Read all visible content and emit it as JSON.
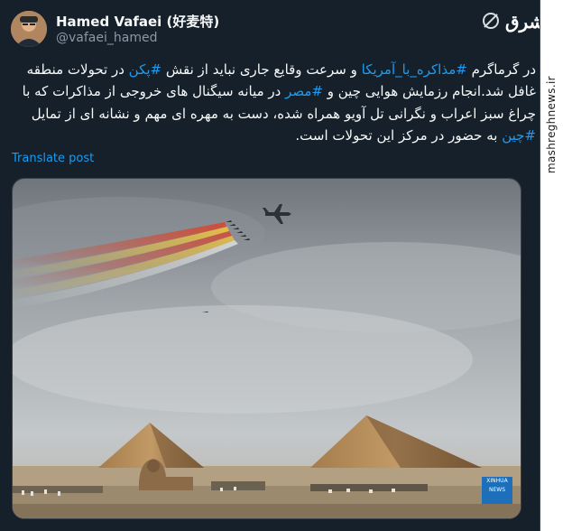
{
  "author": {
    "name": "Hamed Vafaei   (好麦特)",
    "handle": "@vafaei_hamed"
  },
  "tweet": {
    "line1_pre": "در گرماگرم ",
    "hashtag1": "#مذاکره_با_آمریکا",
    "line1_mid": " و سرعت وقایع جاری نباید از نقش ",
    "hashtag2": "#پکن",
    "line1_post": " در تحولات منطقه غافل شد.انجام رزمایش هوایی چین و ",
    "hashtag3": "#مصر",
    "line2": " در میانه سیگنال های خروجی از مذاکرات که با چراغ سبز اعراب و نگرانی تل آویو همراه شده، دست به مهره ای مهم و نشانه ای از تمایل ",
    "hashtag4": "#چین",
    "line3": " به حضور در مرکز این تحولات است."
  },
  "translate_label": "Translate post",
  "logo_text": "مشرق",
  "watermark": "mashreghnews.ir",
  "xinhua_badge": {
    "line1": "XINHUA",
    "line2": "NEWS"
  },
  "colors": {
    "background": "#15202b",
    "link": "#1d9bf0",
    "secondary_text": "#8b98a5"
  }
}
